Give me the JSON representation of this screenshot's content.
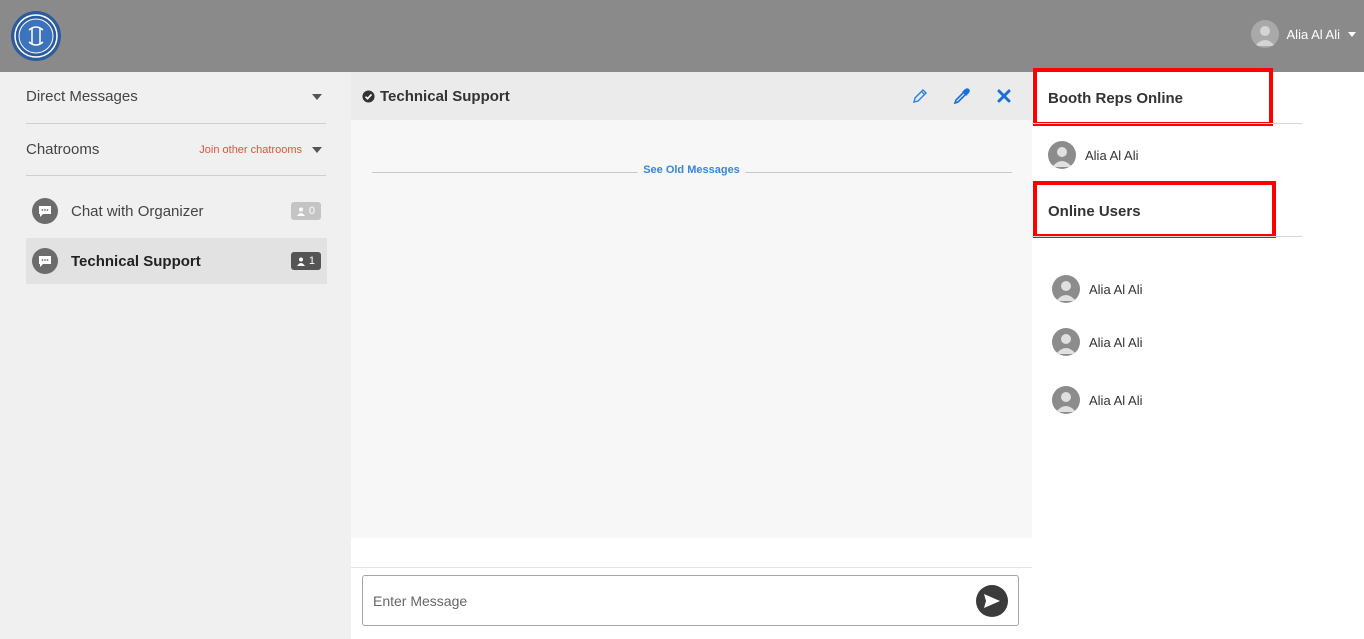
{
  "topbar": {
    "user_name": "Alia Al Ali"
  },
  "sidebar": {
    "direct_messages": "Direct Messages",
    "chatrooms": "Chatrooms",
    "join_other": "Join other chatrooms",
    "rooms": [
      {
        "label": "Chat with Organizer",
        "count": "0",
        "active": false
      },
      {
        "label": "Technical Support",
        "count": "1",
        "active": true
      }
    ]
  },
  "chat": {
    "title": "Technical Support",
    "see_old": "See Old Messages",
    "input_placeholder": "Enter Message"
  },
  "right_panel": {
    "booth_reps_title": "Booth Reps Online",
    "booth_reps": [
      "Alia Al Ali"
    ],
    "online_users_title": "Online Users",
    "online_users": [
      "Alia Al Ali",
      "Alia Al Ali",
      "Alia Al Ali"
    ]
  },
  "colors": {
    "topbar": "#8a8a8a",
    "accent_link": "#3a86d9",
    "join_link": "#e2533c",
    "close_icon": "#1a6fd8",
    "highlight": "#ff0000"
  }
}
